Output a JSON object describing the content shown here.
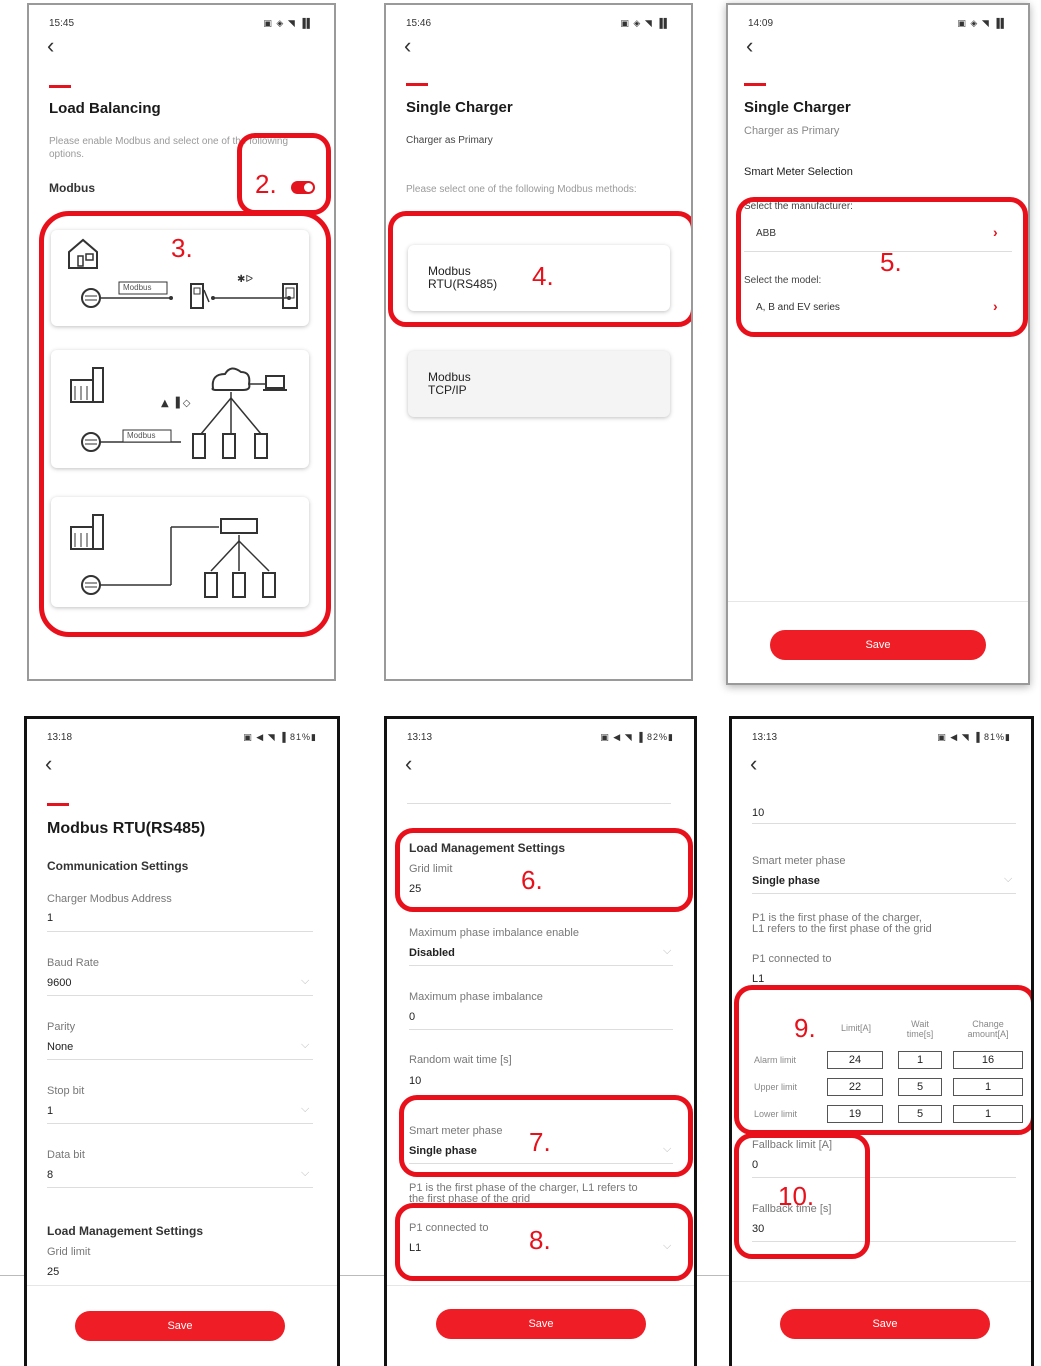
{
  "colors": {
    "accent": "#e3141e",
    "callout": "#e8101a"
  },
  "p1": {
    "time": "15:45",
    "title": "Load Balancing",
    "desc": "Please enable Modbus and select one of the following options.",
    "modbus_label": "Modbus",
    "topo_modbus1": "Modbus",
    "topo_modbus2": "Modbus"
  },
  "p2": {
    "time": "15:46",
    "title": "Single Charger",
    "subtitle": "Charger as Primary",
    "desc": "Please select one of the following Modbus methods:",
    "opt1": "Modbus\nRTU(RS485)",
    "opt2": "Modbus\nTCP/IP"
  },
  "p3": {
    "time": "14:09",
    "title": "Single Charger",
    "subtitle": "Charger as Primary",
    "section": "Smart Meter Selection",
    "manu_label": "Select the manufacturer:",
    "manu_val": "ABB",
    "model_label": "Select the model:",
    "model_val": "A, B and EV series",
    "save": "Save"
  },
  "p4": {
    "time": "13:18",
    "battery": "81%",
    "title": "Modbus RTU(RS485)",
    "section": "Communication Settings",
    "addr_label": "Charger Modbus Address",
    "addr_val": "1",
    "baud_label": "Baud Rate",
    "baud_val": "9600",
    "parity_label": "Parity",
    "parity_val": "None",
    "stop_label": "Stop bit",
    "stop_val": "1",
    "data_label": "Data bit",
    "data_val": "8",
    "lm_title": "Load Management Settings",
    "grid_label": "Grid limit",
    "grid_val": "25",
    "save": "Save"
  },
  "p5": {
    "time": "13:13",
    "battery": "82%",
    "lm_title": "Load Management Settings",
    "grid_label": "Grid limit",
    "grid_val": "25",
    "imb_en_label": "Maximum phase imbalance enable",
    "imb_en_val": "Disabled",
    "imb_label": "Maximum phase imbalance",
    "imb_val": "0",
    "rand_label": "Random wait time [s]",
    "rand_val": "10",
    "smp_label": "Smart meter phase",
    "smp_val": "Single phase",
    "p1_note": "P1 is the first phase of the charger, L1 refers to the first phase of the grid",
    "p1c_label": "P1 connected to",
    "p1c_val": "L1",
    "save": "Save"
  },
  "p6": {
    "time": "13:13",
    "battery": "81%",
    "top_val": "10",
    "smp_label": "Smart meter phase",
    "smp_val": "Single phase",
    "p1_note": "P1 is the first phase of the charger,\nL1 refers to the first phase of the grid",
    "p1c_label": "P1 connected to",
    "p1c_val": "L1",
    "th_limit": "Limit[A]",
    "th_wait": "Wait\ntime[s]",
    "th_change": "Change\namount[A]",
    "rows": [
      {
        "label": "Alarm limit",
        "limit": "24",
        "wait": "1",
        "change": "16"
      },
      {
        "label": "Upper limit",
        "limit": "22",
        "wait": "5",
        "change": "1"
      },
      {
        "label": "Lower limit",
        "limit": "19",
        "wait": "5",
        "change": "1"
      }
    ],
    "fb_label": "Fallback limit [A]",
    "fb_val": "0",
    "fbt_label": "Fallback time [s]",
    "fbt_val": "30",
    "save": "Save"
  },
  "callouts": {
    "c2": "2.",
    "c3": "3.",
    "c4": "4.",
    "c5": "5.",
    "c6": "6.",
    "c7": "7.",
    "c8": "8.",
    "c9": "9.",
    "c10": "10."
  }
}
